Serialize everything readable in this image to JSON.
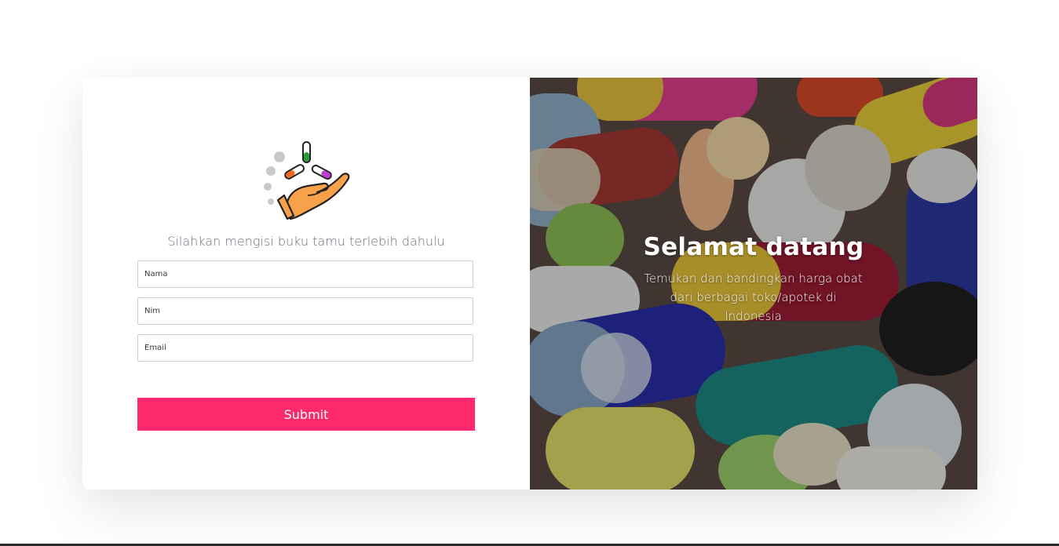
{
  "form": {
    "subtitle": "Silahkan mengisi buku tamu terlebih dahulu",
    "fields": [
      {
        "placeholder": "Nama",
        "value": ""
      },
      {
        "placeholder": "Nim",
        "value": ""
      },
      {
        "placeholder": "Email",
        "value": ""
      }
    ],
    "submit_label": "Submit"
  },
  "hero": {
    "title": "Selamat datang",
    "text": "Temukan dan bandingkan harga obat dari berbagai toko/apotek di Indonesia"
  },
  "colors": {
    "accent": "#ff2a6d",
    "hand": "#f7a24a",
    "pill_green": "#2e9b3a",
    "pill_orange": "#f26a21",
    "pill_purple": "#c43ad9"
  },
  "icons": {
    "logo": "hand-with-pills-icon"
  }
}
